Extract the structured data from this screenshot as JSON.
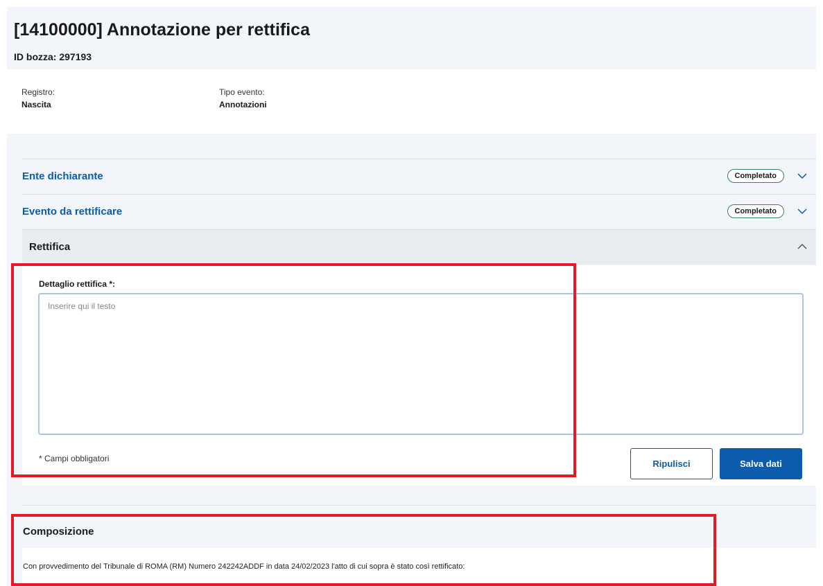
{
  "header": {
    "title": "[14100000] Annotazione per rettifica",
    "draft_id": "ID bozza: 297193"
  },
  "meta": {
    "registro_label": "Registro:",
    "registro_value": "Nascita",
    "tipo_evento_label": "Tipo evento:",
    "tipo_evento_value": "Annotazioni"
  },
  "accordion": {
    "items": [
      {
        "title": "Ente dichiarante",
        "status": "Completato"
      },
      {
        "title": "Evento da rettificare",
        "status": "Completato"
      },
      {
        "title": "Rettifica"
      }
    ]
  },
  "form": {
    "field_label": "Dettaglio rettifica *:",
    "textarea_placeholder": "Inserire qui il testo",
    "required_note": "* Campi obbligatori",
    "clear_label": "Ripulisci",
    "save_label": "Salva dati"
  },
  "composition": {
    "title": "Composizione",
    "text": "Con provvedimento del Tribunale di ROMA (RM) Numero 242242ADDF in data 24/02/2023 l'atto di cui sopra è stato così rettificato:"
  },
  "colors": {
    "accent": "#0b5cad",
    "highlight": "#e41b23",
    "badge_border": "#2e8b57"
  }
}
